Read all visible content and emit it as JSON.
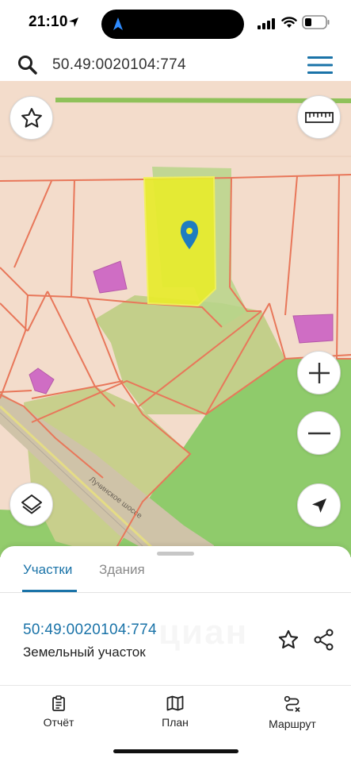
{
  "status_bar": {
    "time": "21:10"
  },
  "search": {
    "query": "50.49:0020104:774",
    "placeholder": ""
  },
  "map": {
    "road_label": "Лучинское шоссе",
    "buttons": {
      "favorite": "star-outline-icon",
      "ruler": "ruler-icon",
      "zoom_in": "plus-icon",
      "zoom_out": "minus-icon",
      "layers": "layers-icon",
      "locate": "navigation-arrow-icon"
    },
    "colors": {
      "parcel_selected": "#e8ec2c",
      "parcel_border": "#e8775a",
      "building": "#cf6dc4",
      "forest": "#8fcb6b",
      "background": "#f3dccb"
    }
  },
  "sheet": {
    "tabs": [
      {
        "label": "Участки",
        "active": true
      },
      {
        "label": "Здания",
        "active": false
      }
    ],
    "result": {
      "cadastral_number": "50:49:0020104:774",
      "type": "Земельный участок"
    },
    "watermark": "циан"
  },
  "bottom_nav": {
    "report": "Отчёт",
    "plan": "План",
    "route": "Маршрут"
  },
  "colors": {
    "accent": "#1a73a8"
  }
}
